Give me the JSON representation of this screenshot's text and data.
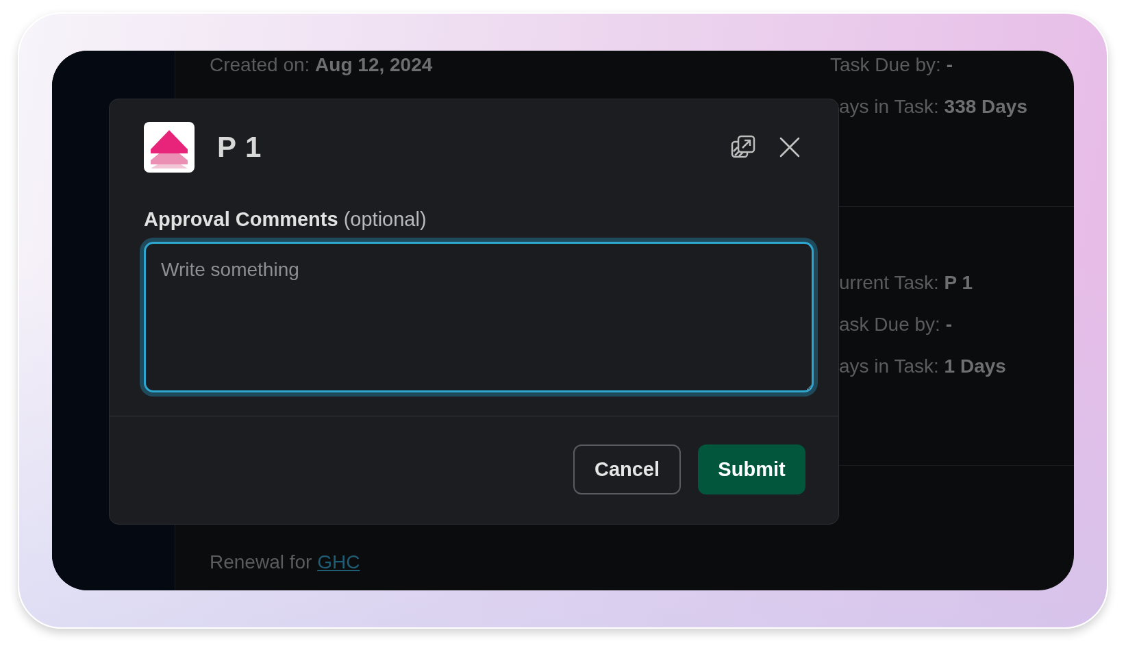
{
  "background": {
    "created": "Created on: **Aug 12, 2024**",
    "right_top": [
      "Task Due by: **-**",
      "ays in Task: **338 Days**"
    ],
    "right_middle": [
      "urrent Task: **P 1**",
      "ask Due by: **-**",
      "ays in Task: **1 Days**"
    ],
    "renewal": {
      "text": "Renewal for",
      "link": "GHC"
    }
  },
  "dialog": {
    "title": "P 1",
    "field": {
      "label": "**Approval Comments** (optional)",
      "placeholder": "Write something",
      "focused": true
    },
    "buttons": [
      {
        "label": "Cancel",
        "kind": "secondary"
      },
      {
        "label": "Submit",
        "kind": "primary"
      }
    ]
  }
}
